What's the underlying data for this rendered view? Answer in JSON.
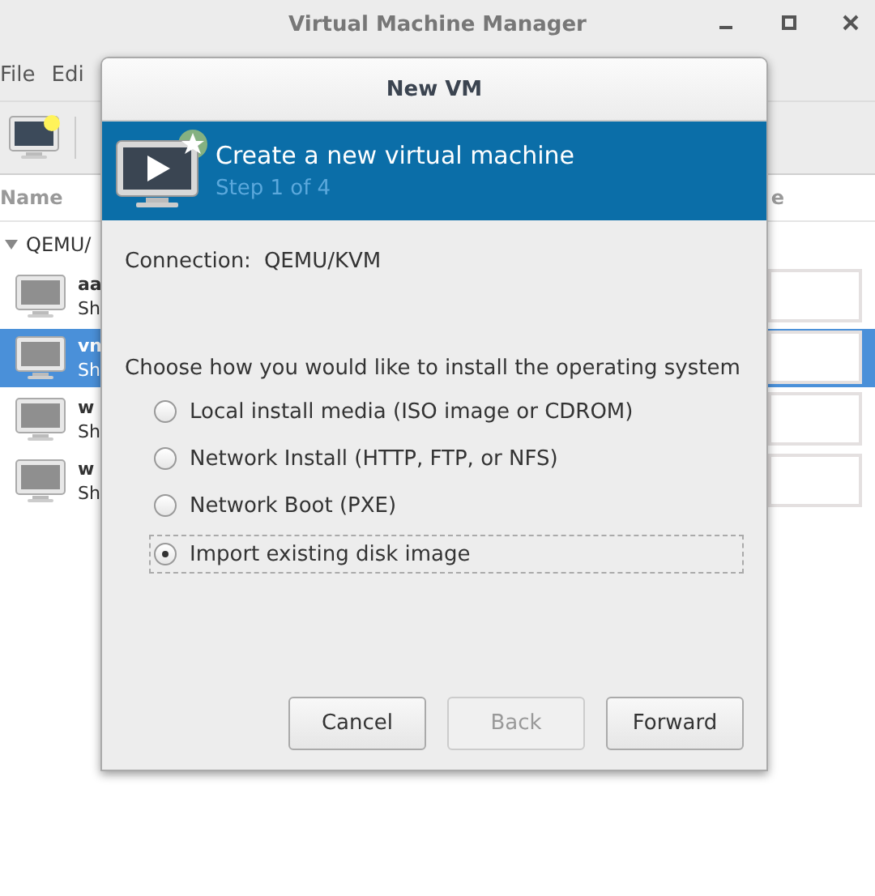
{
  "window": {
    "title": "Virtual Machine Manager"
  },
  "menu": [
    {
      "label": "File"
    },
    {
      "label": "Edi"
    }
  ],
  "columns": [
    {
      "label": "Name"
    },
    {
      "label": "e"
    }
  ],
  "group": {
    "label": "QEMU/",
    "expanded": true
  },
  "vms": [
    {
      "name": "aa",
      "status": "Sh",
      "selected": false
    },
    {
      "name": "vn",
      "status": "Sh",
      "selected": true
    },
    {
      "name": "w",
      "status": "Sh",
      "selected": false
    },
    {
      "name": "w",
      "status": "Sh",
      "selected": false
    }
  ],
  "dialog": {
    "title": "New VM",
    "heading": "Create a new virtual machine",
    "step": "Step 1 of 4",
    "connection_label": "Connection:",
    "connection": "QEMU/KVM",
    "prompt": "Choose how you would like to install the operating system",
    "options": [
      {
        "label": "Local install media (ISO image or CDROM)",
        "selected": false
      },
      {
        "label": "Network Install (HTTP, FTP, or NFS)",
        "selected": false
      },
      {
        "label": "Network Boot (PXE)",
        "selected": false
      },
      {
        "label": "Import existing disk image",
        "selected": true
      }
    ],
    "buttons": [
      {
        "label": "Cancel",
        "disabled": false
      },
      {
        "label": "Back",
        "disabled": true
      },
      {
        "label": "Forward",
        "disabled": false
      }
    ]
  }
}
